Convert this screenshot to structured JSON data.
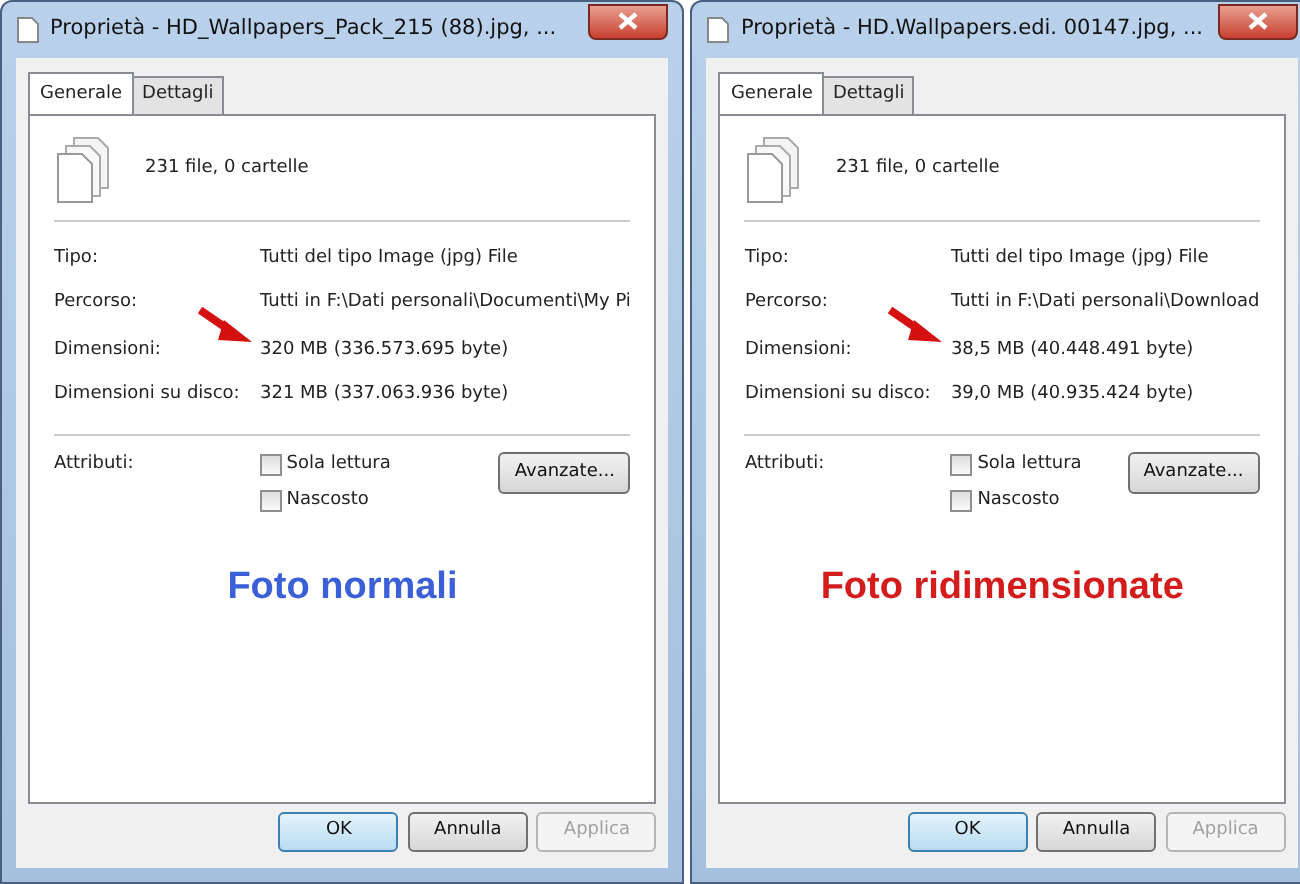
{
  "dialogs": [
    {
      "title": "Proprietà - HD_Wallpapers_Pack_215 (88).jpg, ...",
      "tabs": [
        {
          "label": "Generale",
          "selected": true
        },
        {
          "label": "Dettagli",
          "selected": false
        }
      ],
      "summary": "231 file, 0 cartelle",
      "properties": [
        {
          "label": "Tipo:",
          "value": "Tutti del tipo Image (jpg) File"
        },
        {
          "label": "Percorso:",
          "value": "Tutti in F:\\Dati personali\\Documenti\\My Pi"
        },
        {
          "label": "Dimensioni:",
          "value": "320 MB (336.573.695 byte)"
        },
        {
          "label": "Dimensioni su disco:",
          "value": "321 MB (337.063.936 byte)"
        }
      ],
      "attributes_label": "Attributi:",
      "attributes": [
        {
          "label": "Sola lettura",
          "checked": false
        },
        {
          "label": "Nascosto",
          "checked": false
        }
      ],
      "advanced_button": "Avanzate...",
      "caption": {
        "text": "Foto normali",
        "color": "#3a5fd6"
      },
      "buttons": [
        {
          "label": "OK",
          "disabled": false
        },
        {
          "label": "Annulla",
          "disabled": false
        },
        {
          "label": "Applica",
          "disabled": true
        }
      ]
    },
    {
      "title": "Proprietà - HD.Wallpapers.edi. 00147.jpg, ...",
      "tabs": [
        {
          "label": "Generale",
          "selected": true
        },
        {
          "label": "Dettagli",
          "selected": false
        }
      ],
      "summary": "231 file, 0 cartelle",
      "properties": [
        {
          "label": "Tipo:",
          "value": "Tutti del tipo Image (jpg) File"
        },
        {
          "label": "Percorso:",
          "value": "Tutti in F:\\Dati personali\\Download"
        },
        {
          "label": "Dimensioni:",
          "value": "38,5 MB (40.448.491 byte)"
        },
        {
          "label": "Dimensioni su disco:",
          "value": "39,0 MB (40.935.424 byte)"
        }
      ],
      "attributes_label": "Attributi:",
      "attributes": [
        {
          "label": "Sola lettura",
          "checked": false
        },
        {
          "label": "Nascosto",
          "checked": false
        }
      ],
      "advanced_button": "Avanzate...",
      "caption": {
        "text": "Foto ridimensionate",
        "color": "#d41c1c"
      },
      "buttons": [
        {
          "label": "OK",
          "disabled": false
        },
        {
          "label": "Annulla",
          "disabled": false
        },
        {
          "label": "Applica",
          "disabled": true
        }
      ]
    }
  ]
}
